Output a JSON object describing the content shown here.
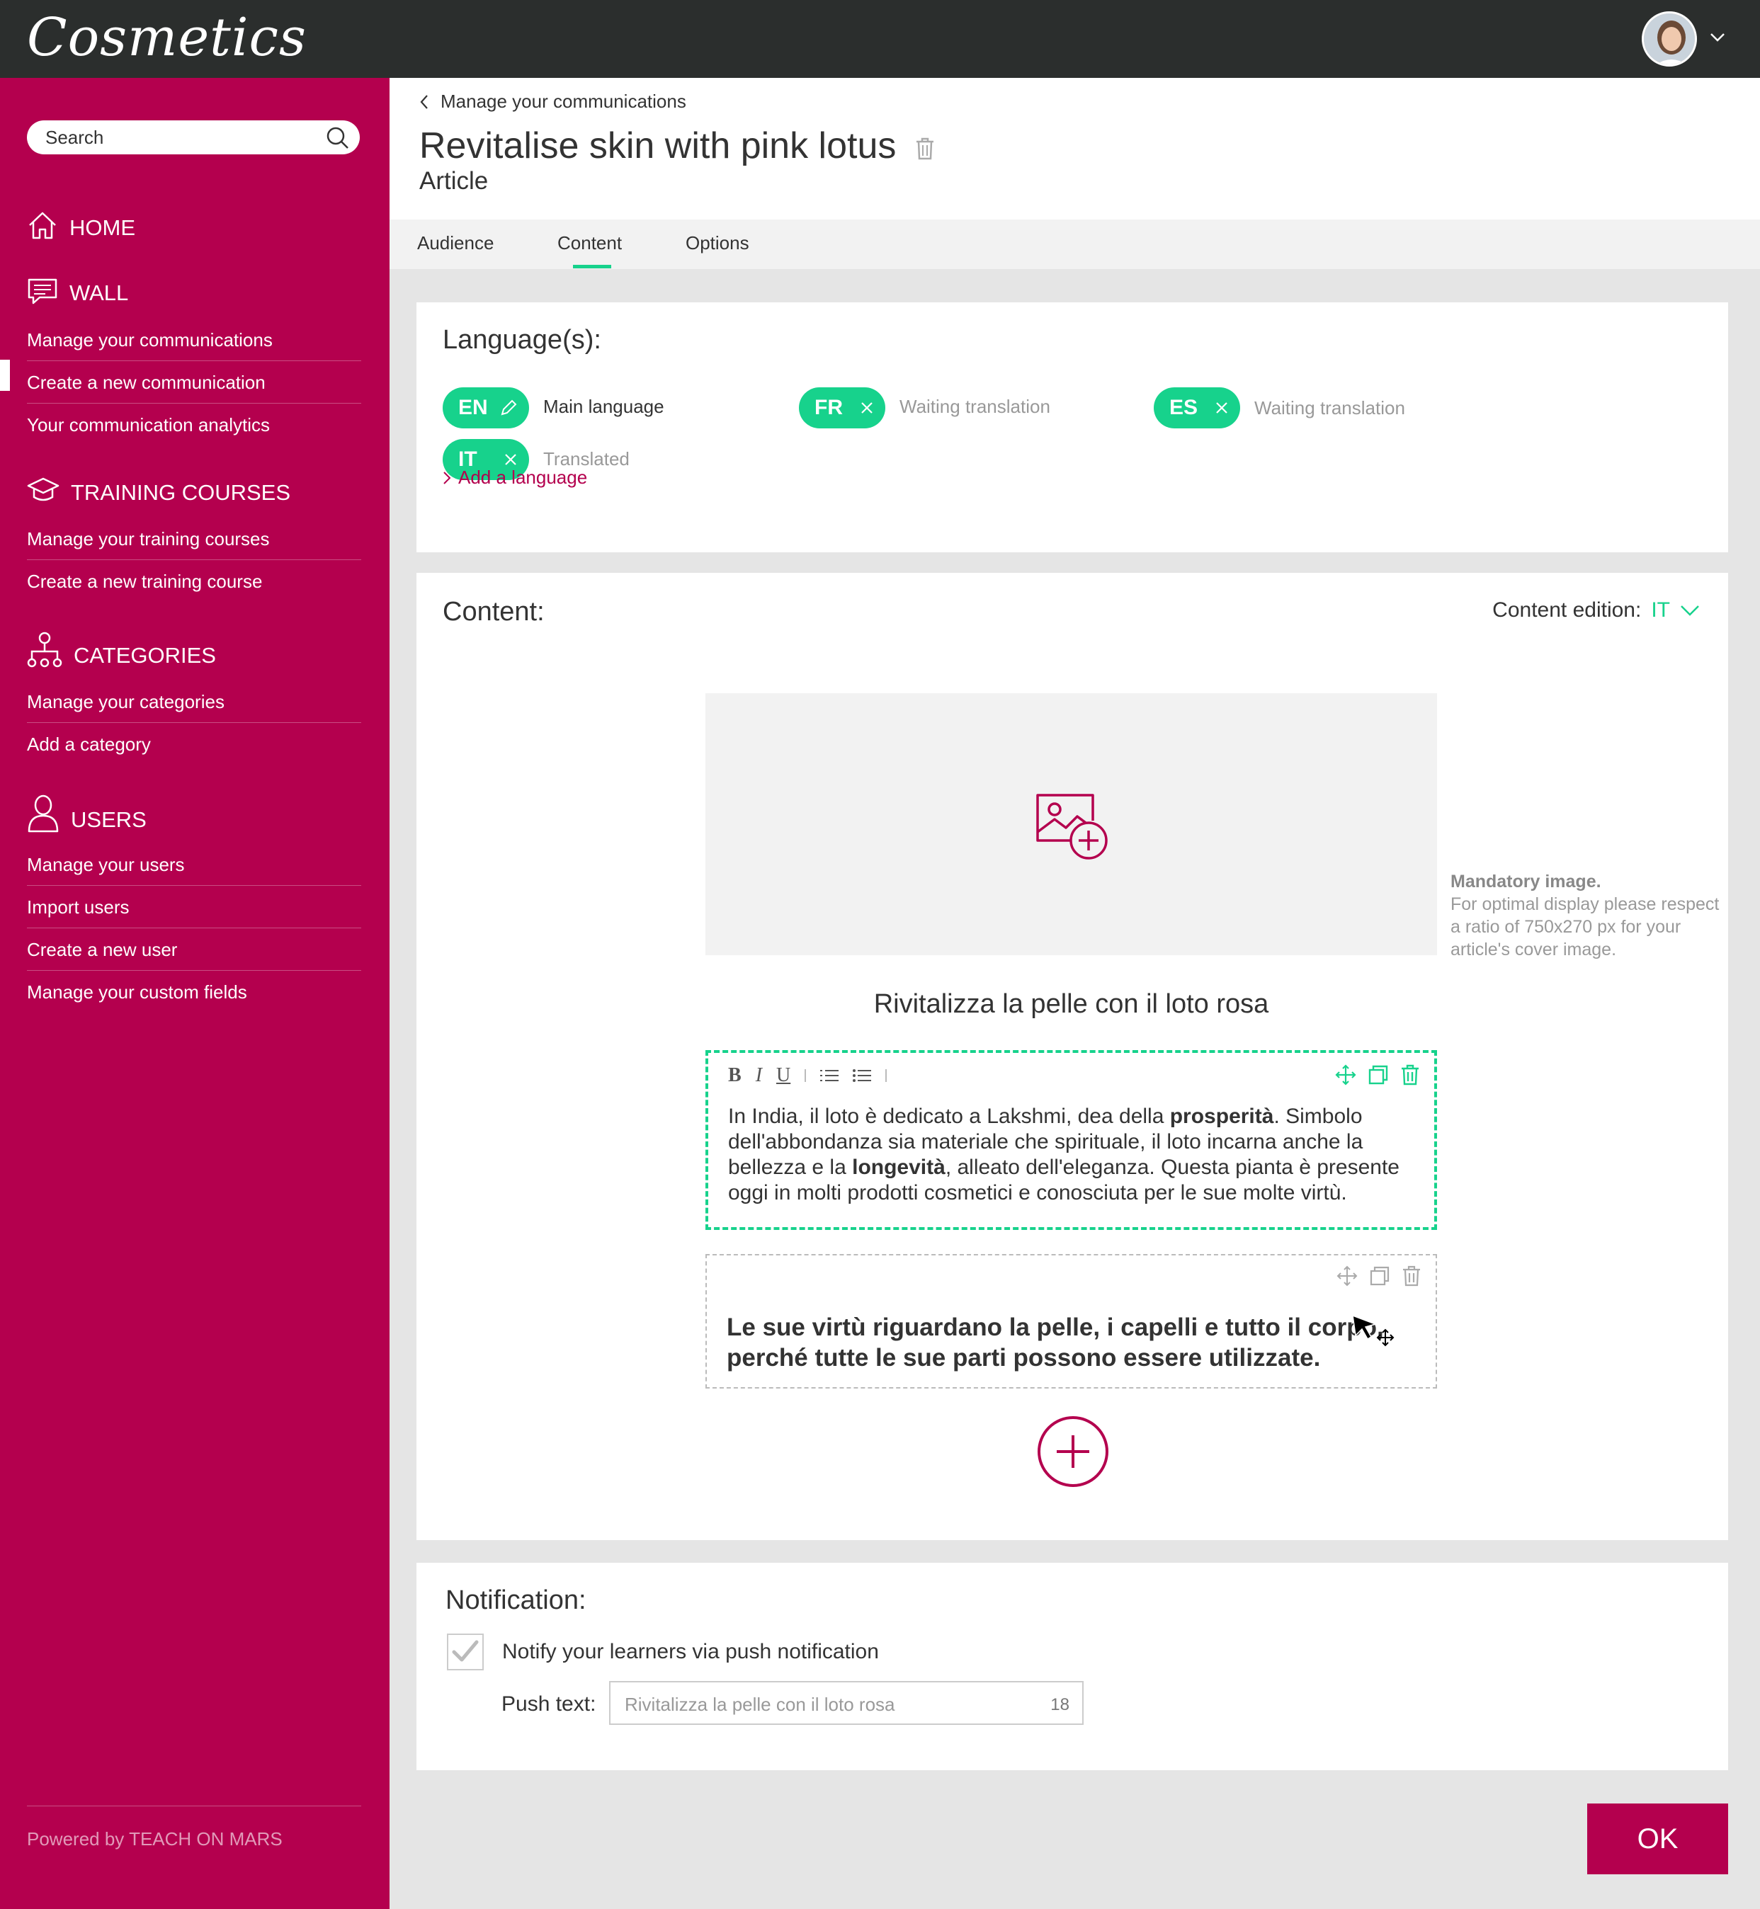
{
  "app": {
    "logo": "Cosmetics"
  },
  "colors": {
    "brand": "#b4004e",
    "accent": "#17d28c",
    "topbar": "#2b2e2d"
  },
  "search": {
    "placeholder": "Search"
  },
  "sidebar": {
    "home": {
      "label": "HOME",
      "icon": "home-icon"
    },
    "wall": {
      "label": "WALL",
      "icon": "chat-icon",
      "items": [
        "Manage your communications",
        "Create a new communication",
        "Your communication analytics"
      ]
    },
    "training": {
      "label": "TRAINING COURSES",
      "icon": "graduation-cap-icon",
      "items": [
        "Manage your training courses",
        "Create a new training course"
      ]
    },
    "categories": {
      "label": "CATEGORIES",
      "icon": "hierarchy-icon",
      "items": [
        "Manage your categories",
        "Add a category"
      ]
    },
    "users": {
      "label": "USERS",
      "icon": "user-icon",
      "items": [
        "Manage your users",
        "Import users",
        "Create a new user",
        "Manage your custom fields"
      ]
    },
    "powered_prefix": "Powered by",
    "powered_brand": "TEACH ON MARS"
  },
  "header": {
    "breadcrumb": "Manage your communications",
    "title": "Revitalise skin with pink lotus",
    "subtitle": "Article"
  },
  "tabs": [
    {
      "label": "Audience",
      "active": false
    },
    {
      "label": "Content",
      "active": true
    },
    {
      "label": "Options",
      "active": false
    }
  ],
  "languages": {
    "title": "Language(s):",
    "items": [
      {
        "code": "EN",
        "status": "Main language",
        "icon": "pencil-icon"
      },
      {
        "code": "FR",
        "status": "Waiting translation",
        "icon": "close-icon"
      },
      {
        "code": "ES",
        "status": "Waiting translation",
        "icon": "close-icon"
      },
      {
        "code": "IT",
        "status": "Translated",
        "icon": "close-icon"
      }
    ],
    "add_label": "Add a language"
  },
  "content": {
    "title": "Content:",
    "edition_label": "Content edition:",
    "edition_lang": "IT",
    "mandatory_title": "Mandatory image.",
    "mandatory_text": "For optimal display please respect a ratio of 750x270 px for your article's cover image.",
    "article_title": "Rivitalizza la pelle con il loto rosa",
    "toolbar": {
      "bold": "B",
      "italic": "I",
      "underline": "U"
    },
    "block1": {
      "p1": "In India, il loto è dedicato a Lakshmi, dea della ",
      "b1": "prosperità",
      "p2": ". Simbolo dell'abbondanza sia materiale che spirituale, il loto incarna anche la bellezza e la ",
      "b2": "longevità",
      "p3": ", alleato dell'eleganza. Questa pianta è presente oggi in molti prodotti cosmetici e conosciuta per le sue molte virtù."
    },
    "block2": {
      "text": "Le sue virtù riguardano la pelle, i capelli e tutto il corpo, perché tutte le sue parti possono essere utilizzate."
    }
  },
  "notification": {
    "title": "Notification:",
    "checkbox_label": "Notify your learners via push notification",
    "checked": true,
    "push_label": "Push text:",
    "push_value": "Rivitalizza la pelle con il loto rosa",
    "push_count": "18"
  },
  "actions": {
    "ok": "OK"
  }
}
